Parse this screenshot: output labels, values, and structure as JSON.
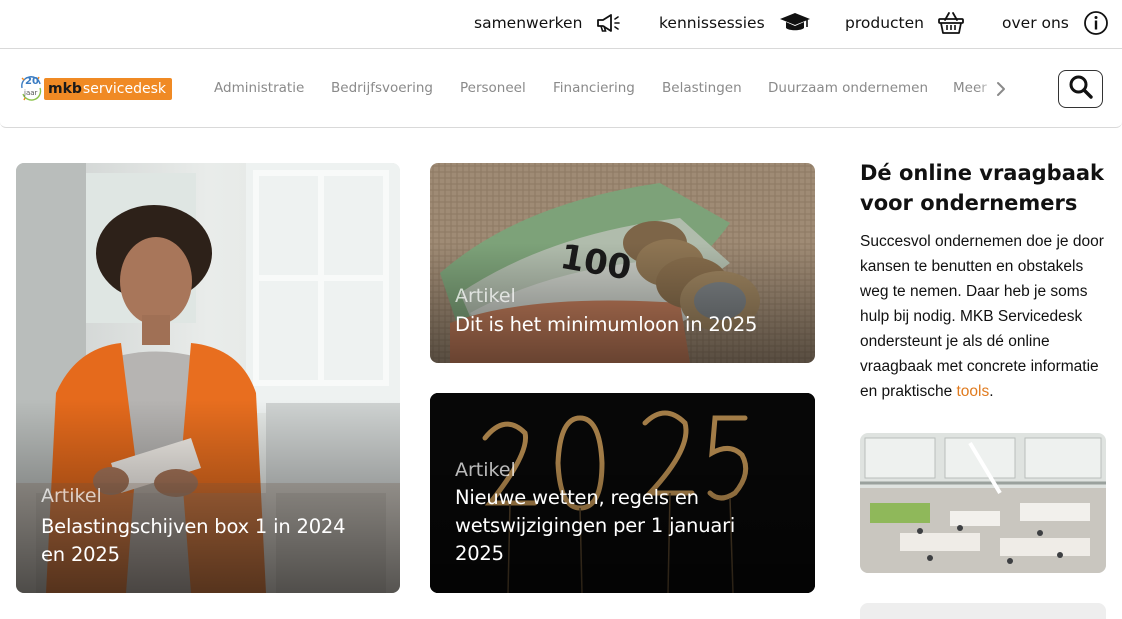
{
  "topbar": {
    "links": [
      {
        "label": "samenwerken",
        "icon": "megaphone-icon"
      },
      {
        "label": "kennissessies",
        "icon": "graduation-cap-icon"
      },
      {
        "label": "producten",
        "icon": "basket-icon"
      },
      {
        "label": "over ons",
        "icon": "info-icon"
      }
    ]
  },
  "logo": {
    "badge_number": "20",
    "badge_word": "jaar",
    "brand_bold": "mkb",
    "brand_rest": "servicedesk"
  },
  "nav": {
    "items": [
      "Administratie",
      "Bedrijfsvoering",
      "Personeel",
      "Financiering",
      "Belastingen",
      "Duurzaam ondernemen"
    ],
    "more_label": "Meer",
    "chevron_icon": "chevron-right-icon",
    "search_icon": "search-icon"
  },
  "cards": [
    {
      "kicker": "Artikel",
      "title": "Belastingschijven box 1 in 2024 en 2025"
    },
    {
      "kicker": "Artikel",
      "title": "Dit is het minimumloon in 2025"
    },
    {
      "kicker": "Artikel",
      "title": "Nieuwe wetten, regels en wetswijzigingen per 1 januari 2025"
    }
  ],
  "sidebar": {
    "title": "Dé online vraagbaak voor ondernemers",
    "text": "Succesvol ondernemen doe je door kansen te benutten en obstakels weg te nemen. Daar heb je soms hulp bij nodig. MKB Servicedesk ondersteunt je als dé online vraagbaak met concrete informatie en praktische ",
    "link_label": "tools",
    "text_end": "."
  },
  "colors": {
    "brand_orange": "#f08a24",
    "link_orange": "#e07b1f",
    "nav_gray": "#8a8a8a"
  }
}
